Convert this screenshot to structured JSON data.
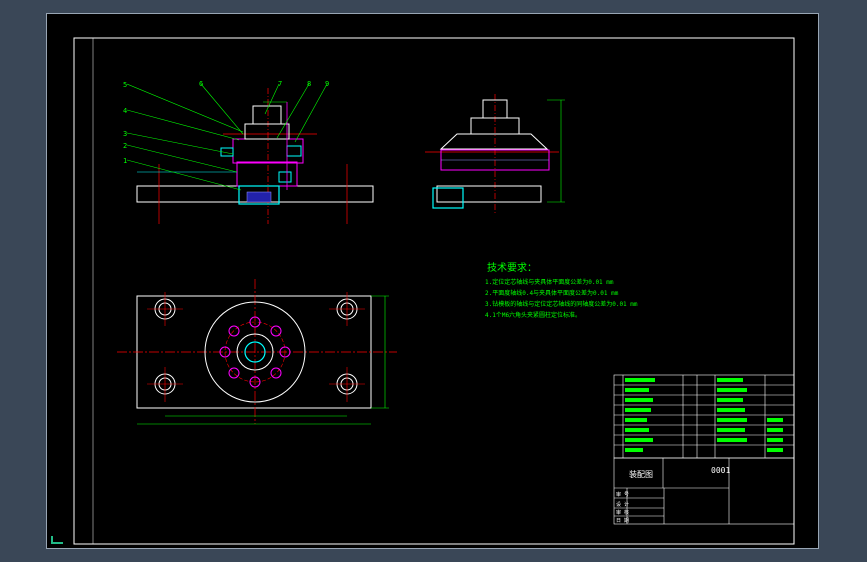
{
  "colors": {
    "background": "#000000",
    "frame": "#ffffff",
    "part": "#00ffff",
    "centerline": "#ff0000",
    "dimension": "#00ff00",
    "accent": "#ff00ff",
    "hatch": "#9999ff",
    "text": "#00ff00"
  },
  "callouts": [
    "5",
    "4",
    "3",
    "2",
    "1",
    "6",
    "7",
    "8",
    "9"
  ],
  "tech_requirements": {
    "title": "技术要求：",
    "lines": [
      "1.定位定芯轴线与夹具体平面度公差为0.01 mm",
      "2.平面度轴线0.4与夹具体平面度公差为0.01 mm",
      "3.钻模板的轴线与定位定芯轴线的同轴度公差为0.01 mm",
      "4.1个M6六角头夹紧圆柱定位标准。"
    ]
  },
  "title_block": {
    "drawing_name": "装配图",
    "drawing_no": "0001",
    "fields": [
      "审 号",
      "设 计",
      "审 核",
      "日 期"
    ]
  }
}
